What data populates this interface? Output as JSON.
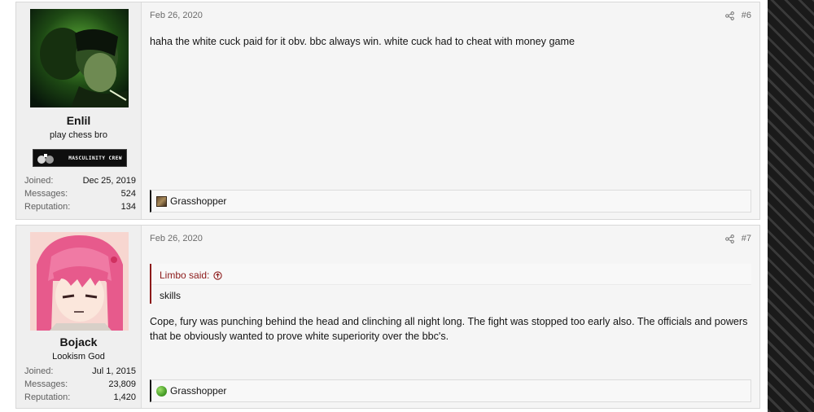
{
  "posts": [
    {
      "user": {
        "name": "Enlil",
        "title": "play chess bro",
        "banner": "MASCULINITY CREW",
        "stats": [
          {
            "label": "Joined:",
            "value": "Dec 25, 2019"
          },
          {
            "label": "Messages:",
            "value": "524"
          },
          {
            "label": "Reputation:",
            "value": "134"
          }
        ]
      },
      "date": "Feb 26, 2020",
      "number": "#6",
      "body": "haha the white cuck paid for it obv. bbc always win. white cuck had to cheat with money game",
      "reaction": {
        "name": "Grasshopper"
      }
    },
    {
      "user": {
        "name": "Bojack",
        "title": "Lookism God",
        "stats": [
          {
            "label": "Joined:",
            "value": "Jul 1, 2015"
          },
          {
            "label": "Messages:",
            "value": "23,809"
          },
          {
            "label": "Reputation:",
            "value": "1,420"
          }
        ]
      },
      "date": "Feb 26, 2020",
      "number": "#7",
      "quote": {
        "author": "Limbo said:",
        "text": "skills"
      },
      "body": "Cope, fury was punching behind the head and clinching all night long. The fight was stopped too early also. The officials and powers that be obviously wanted to prove white superiority over the bbc's.",
      "reaction": {
        "name": "Grasshopper"
      }
    }
  ],
  "colors": {
    "quote_accent": "#8c1a1a",
    "post_bg": "#f5f5f5",
    "sidebar_bg": "#efefef"
  },
  "icons": [
    "share-icon",
    "arrow-up-circle-icon",
    "reaction-icon",
    "like-icon"
  ]
}
